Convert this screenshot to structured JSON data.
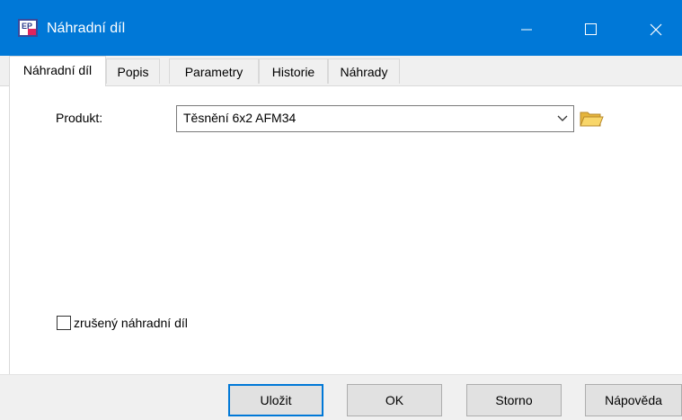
{
  "window": {
    "title": "Náhradní díl",
    "icon": "ep-app-icon",
    "controls": {
      "minimize": "minimize-icon",
      "maximize": "maximize-icon",
      "close": "close-icon"
    }
  },
  "tabs": [
    {
      "label": "Náhradní díl",
      "active": true
    },
    {
      "label": "Popis"
    },
    {
      "label": "Parametry"
    },
    {
      "label": "Historie"
    },
    {
      "label": "Náhrady"
    }
  ],
  "form": {
    "product_label": "Produkt:",
    "product_value": "Těsnění 6x2 AFM34",
    "cancelled_label": "zrušený náhradní díl",
    "cancelled_checked": false
  },
  "buttons": {
    "save": "Uložit",
    "ok": "OK",
    "cancel": "Storno",
    "help": "Nápověda"
  },
  "colors": {
    "titlebar": "#0078d7",
    "accent": "#0078d7",
    "folder": "#f3c74a"
  }
}
